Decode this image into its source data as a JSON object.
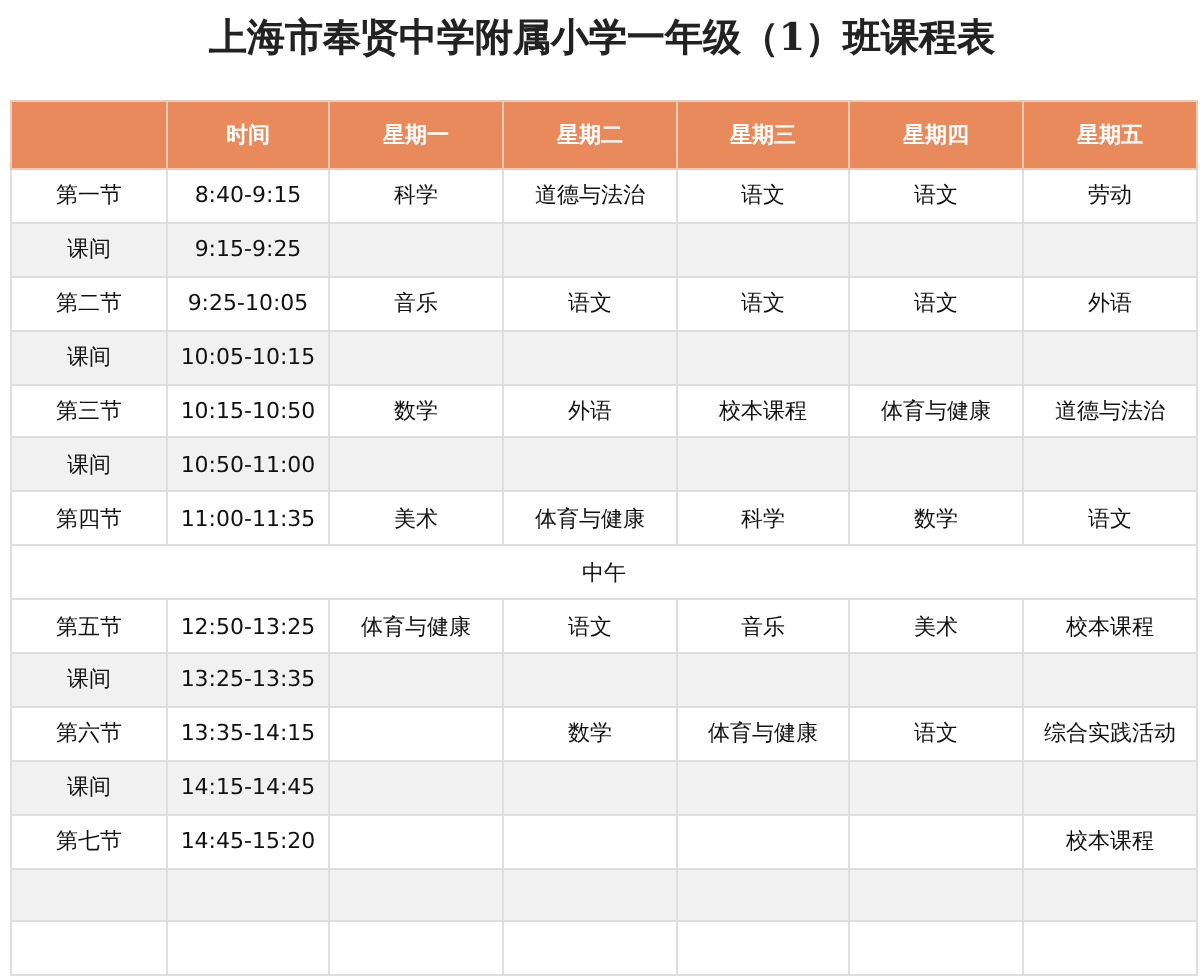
{
  "title": "上海市奉贤中学附属小学一年级（1）班课程表",
  "columns": [
    "时间",
    "星期一",
    "星期二",
    "星期三",
    "星期四",
    "星期五"
  ],
  "rows": [
    {
      "kind": "period",
      "label": "第一节",
      "time": "8:40-9:15",
      "subjects": {
        "mon": "科学",
        "tue": "道德与法治",
        "wed": "语文",
        "thu": "语文",
        "fri": "劳动"
      }
    },
    {
      "kind": "break",
      "label": "课间",
      "time": "9:15-9:25"
    },
    {
      "kind": "period",
      "label": "第二节",
      "time": "9:25-10:05",
      "subjects": {
        "mon": "音乐",
        "tue": "语文",
        "wed": "语文",
        "thu": "语文",
        "fri": "外语"
      }
    },
    {
      "kind": "break",
      "label": "课间",
      "time": "10:05-10:15"
    },
    {
      "kind": "period",
      "label": "第三节",
      "time": "10:15-10:50",
      "subjects": {
        "mon": "数学",
        "tue": "外语",
        "wed": "校本课程",
        "thu": "体育与健康",
        "fri": "道德与法治"
      }
    },
    {
      "kind": "break",
      "label": "课间",
      "time": "10:50-11:00"
    },
    {
      "kind": "period",
      "label": "第四节",
      "time": "11:00-11:35",
      "subjects": {
        "mon": "美术",
        "tue": "体育与健康",
        "wed": "科学",
        "thu": "数学",
        "fri": "语文"
      }
    },
    {
      "kind": "noon",
      "note": "中午"
    },
    {
      "kind": "period",
      "label": "第五节",
      "time": "12:50-13:25",
      "subjects": {
        "mon": "体育与健康",
        "tue": "语文",
        "wed": "音乐",
        "thu": "美术",
        "fri": "校本课程"
      }
    },
    {
      "kind": "break",
      "label": "课间",
      "time": "13:25-13:35"
    },
    {
      "kind": "period",
      "label": "第六节",
      "time": "13:35-14:15",
      "subjects": {
        "tue": "数学",
        "wed": "体育与健康",
        "thu": "语文",
        "fri": "综合实践活动"
      }
    },
    {
      "kind": "break",
      "label": "课间",
      "time": "14:15-14:45"
    },
    {
      "kind": "period",
      "label": "第七节",
      "time": "14:45-15:20",
      "subjects": {
        "fri": "校本课程"
      }
    },
    {
      "kind": "blank",
      "shaded": true
    },
    {
      "kind": "blank",
      "shaded": false
    }
  ]
}
